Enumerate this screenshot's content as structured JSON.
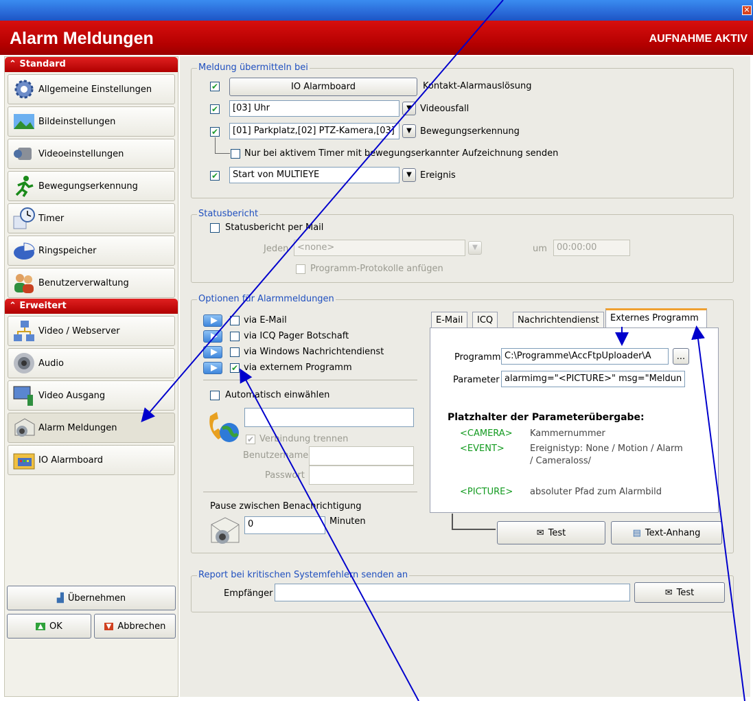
{
  "window": {
    "close_glyph": "✕"
  },
  "header": {
    "title": "Alarm Meldungen",
    "status": "AUFNAHME AKTIV"
  },
  "sidebar": {
    "sections": [
      {
        "label": "Standard",
        "arrow": "≈"
      },
      {
        "label": "Erweitert",
        "arrow": "≈"
      }
    ],
    "items": [
      {
        "label": "Allgemeine Einstellungen",
        "icon": "gear-icon"
      },
      {
        "label": "Bildeinstellungen",
        "icon": "landscape-icon"
      },
      {
        "label": "Videoeinstellungen",
        "icon": "camcorder-icon"
      },
      {
        "label": "Bewegungserkennung",
        "icon": "running-man-icon"
      },
      {
        "label": "Timer",
        "icon": "clock-calendar-icon"
      },
      {
        "label": "Ringspeicher",
        "icon": "pie-disk-icon"
      },
      {
        "label": "Benutzerverwaltung",
        "icon": "users-icon"
      },
      {
        "label": "Video / Webserver",
        "icon": "network-icon"
      },
      {
        "label": "Audio",
        "icon": "speaker-icon"
      },
      {
        "label": "Video Ausgang",
        "icon": "monitor-output-icon"
      },
      {
        "label": "Alarm Meldungen",
        "icon": "alarm-mail-icon",
        "selected": true
      },
      {
        "label": "IO Alarmboard",
        "icon": "io-board-icon"
      }
    ],
    "apply_label": "Übernehmen",
    "ok_label": "OK",
    "cancel_label": "Abbrechen"
  },
  "meldung": {
    "legend": "Meldung übermitteln bei",
    "rows": [
      {
        "checked": true,
        "button": "IO Alarmboard",
        "label": "Kontakt-Alarmauslösung"
      },
      {
        "checked": true,
        "value": "[03] Uhr",
        "label": "Videousfall"
      },
      {
        "checked": true,
        "value": "[01] Parkplatz,[02] PTZ-Kamera,[03]",
        "label": "Bewegungserkennung"
      },
      {
        "checked": true,
        "value": "Start von MULTIEYE",
        "label": "Ereignis"
      }
    ],
    "timer_option": "Nur bei aktivem Timer mit bewegungserkannter Aufzeichnung senden",
    "timer_checked": false
  },
  "status": {
    "legend": "Statusbericht",
    "mail_label": "Statusbericht per Mail",
    "jeden_label": "Jeden",
    "jeden_value": "<none>",
    "um_label": "um",
    "time_value": "00:00:00",
    "protokolle_label": "Programm-Protokolle anfügen"
  },
  "optionen": {
    "legend": "Optionen für Alarmmeldungen",
    "channels": [
      {
        "label": "via E-Mail",
        "checked": false
      },
      {
        "label": "via ICQ Pager Botschaft",
        "checked": false
      },
      {
        "label": "via Windows Nachrichtendienst",
        "checked": false
      },
      {
        "label": "via externem Programm",
        "checked": true
      }
    ],
    "auto_dial_label": "Automatisch einwählen",
    "disconnect_label": "Verbindung trennen",
    "user_label": "Benutzername",
    "password_label": "Passwort",
    "pause_label": "Pause zwischen Benachrichtigung",
    "pause_value": "0",
    "pause_unit": "Minuten",
    "tabs": [
      "E-Mail",
      "ICQ",
      "Nachrichtendienst",
      "Externes Programm"
    ],
    "programm_label": "Programm",
    "programm_value": "C:\\Programme\\AccFtpUploader\\A",
    "browse_label": "...",
    "parameter_label": "Parameter",
    "parameter_value": "alarmimg=\"<PICTURE>\" msg=\"Meldun",
    "platzhalter_title": "Platzhalter der Parameterübergabe:",
    "placeholders": [
      {
        "key": "<CAMERA>",
        "desc": "Kammernummer"
      },
      {
        "key": "<EVENT>",
        "desc": "Ereignistyp: None / Motion / Alarm",
        "desc2": "/ Cameraloss/"
      },
      {
        "key": "<PICTURE>",
        "desc": "absoluter Pfad zum Alarmbild"
      }
    ],
    "test_label": "Test",
    "textanhang_label": "Text-Anhang"
  },
  "report": {
    "legend": "Report bei kritischen Systemfehlern senden an",
    "empfaenger_label": "Empfänger",
    "empfaenger_value": "",
    "test_label": "Test"
  },
  "colors": {
    "accent_red": "#c00000",
    "titlebar_blue": "#2a6ad8",
    "annotation_arrow": "#0000cc",
    "placeholder_green": "#129a1f"
  }
}
